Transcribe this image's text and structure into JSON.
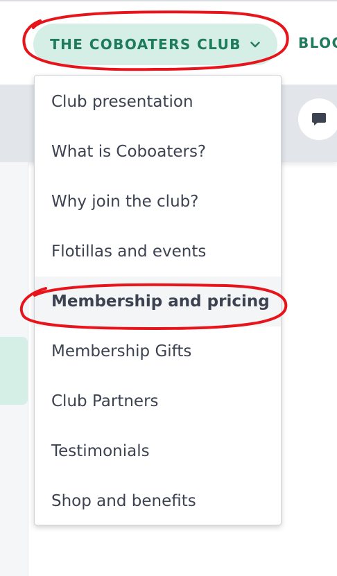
{
  "header": {
    "nav_primary_label": "THE COBOATERS CLUB",
    "nav_secondary_label": "BLOG"
  },
  "dropdown": {
    "items": [
      {
        "label": "Club presentation"
      },
      {
        "label": "What is Coboaters?"
      },
      {
        "label": "Why join the club?"
      },
      {
        "label": "Flotillas and events"
      },
      {
        "label": "Membership and pricing",
        "highlighted": true
      },
      {
        "label": "Membership Gifts"
      },
      {
        "label": "Club Partners"
      },
      {
        "label": "Testimonials"
      },
      {
        "label": "Shop and benefits"
      }
    ]
  },
  "icons": {
    "nav_chevron": "chevron-down-icon",
    "chat": "chat-bubble-icon"
  },
  "colors": {
    "brand_green": "#1f7b5e",
    "pill_background": "#d6efe6",
    "annotation_red": "#e8141b",
    "band_gray": "#e2e5e9",
    "menu_text": "#3c4250"
  }
}
